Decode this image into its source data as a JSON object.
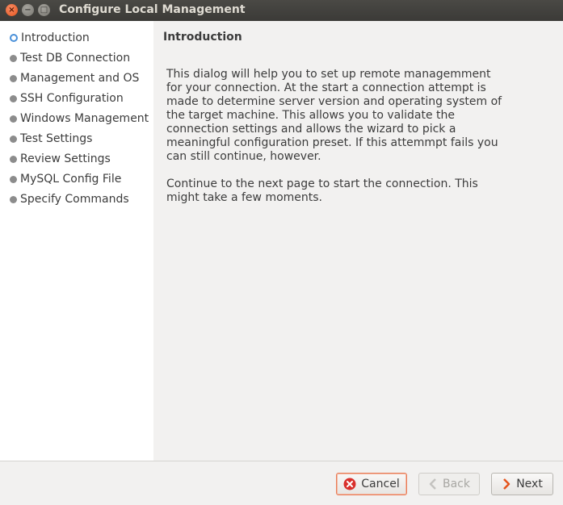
{
  "window": {
    "title": "Configure Local Management",
    "controls": {
      "close_icon": "close-icon",
      "minimize_icon": "minimize-icon",
      "maximize_icon": "maximize-icon"
    }
  },
  "sidebar": {
    "steps": [
      {
        "label": "Introduction",
        "active": true
      },
      {
        "label": "Test DB Connection",
        "active": false
      },
      {
        "label": "Management and OS",
        "active": false
      },
      {
        "label": "SSH Configuration",
        "active": false
      },
      {
        "label": "Windows Management",
        "active": false
      },
      {
        "label": "Test Settings",
        "active": false
      },
      {
        "label": "Review Settings",
        "active": false
      },
      {
        "label": "MySQL Config File",
        "active": false
      },
      {
        "label": "Specify Commands",
        "active": false
      }
    ]
  },
  "main": {
    "heading": "Introduction",
    "paragraphs": [
      "This dialog will help you to set up remote managemment for your connection. At the start a connection attempt is made to determine server version and operating system of the target machine. This allows you to validate the connection settings and allows the wizard to pick a meaningful configuration preset. If this attemmpt fails you can still continue, however.",
      "Continue to the next page to start the connection. This might take a few moments."
    ]
  },
  "footer": {
    "cancel_label": "Cancel",
    "back_label": "Back",
    "next_label": "Next"
  },
  "colors": {
    "accent": "#e97c57",
    "active_step": "#4a90d9",
    "titlebar": "#3b3a37"
  }
}
